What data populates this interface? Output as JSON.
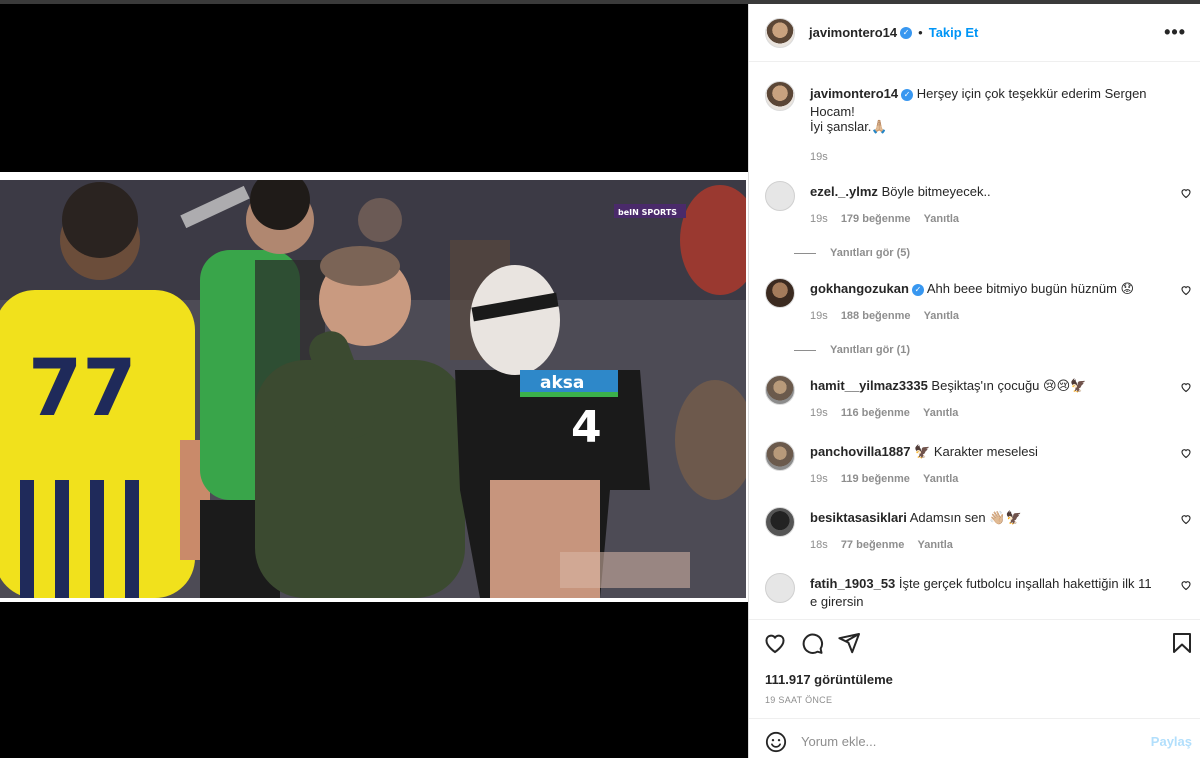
{
  "post": {
    "author": "javimontero14",
    "follow_label": "Takip Et",
    "more_label": "•••",
    "caption_text": "Herşey için çok teşekkür ederim Sergen Hocam!",
    "caption_line2": "İyi şanslar.🙏🏼",
    "caption_time": "19s"
  },
  "media": {
    "broadcaster_badge": "beIN SPORTS",
    "sponsor_text": "aksa",
    "jersey_number_left": "77"
  },
  "comments": [
    {
      "user": "ezel._.ylmz",
      "verified": false,
      "text": "Böyle bitmeyecek..",
      "time": "19s",
      "likes": "179 beğenme",
      "reply": "Yanıtla",
      "view_replies": "Yanıtları gör (5)"
    },
    {
      "user": "gokhangozukan",
      "verified": true,
      "text": "Ahh beee bitmiyo bugün hüznüm 😟",
      "time": "19s",
      "likes": "188 beğenme",
      "reply": "Yanıtla",
      "view_replies": "Yanıtları gör (1)"
    },
    {
      "user": "hamit__yilmaz3335",
      "verified": false,
      "text": "Beşiktaş'ın çocuğu 😢😢🦅",
      "time": "19s",
      "likes": "116 beğenme",
      "reply": "Yanıtla"
    },
    {
      "user": "panchovilla1887",
      "verified": false,
      "text": "🦅 Karakter meselesi",
      "time": "19s",
      "likes": "119 beğenme",
      "reply": "Yanıtla"
    },
    {
      "user": "besiktasasiklari",
      "verified": false,
      "text": "Adamsın sen 👋🏼🦅",
      "time": "18s",
      "likes": "77 beğenme",
      "reply": "Yanıtla"
    },
    {
      "user": "fatih_1903_53",
      "verified": false,
      "text": "İşte gerçek futbolcu inşallah hakettiğin ilk 11 e girersin"
    }
  ],
  "footer": {
    "views": "111.917 görüntüleme",
    "time_ago": "19 SAAT ÖNCE",
    "comment_placeholder": "Yorum ekle...",
    "post_label": "Paylaş"
  },
  "colors": {
    "link_blue": "#0095f6",
    "verified_blue": "#3897f0",
    "muted": "#8e8e8e"
  }
}
